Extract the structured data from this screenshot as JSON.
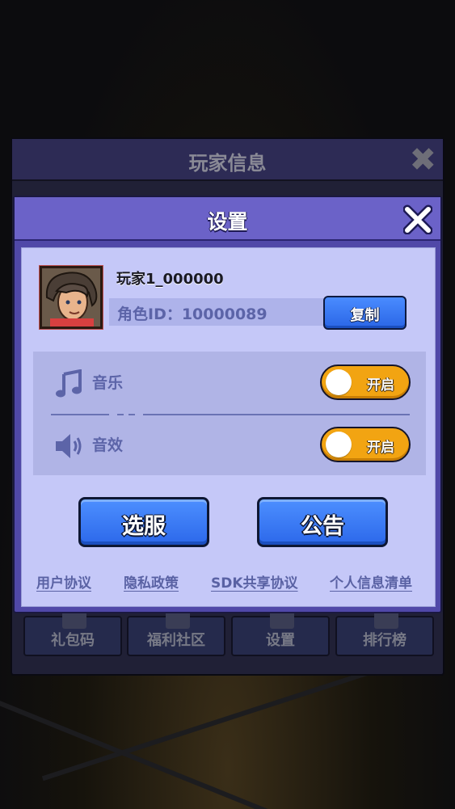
{
  "background_panel": {
    "title": "玩家信息",
    "close_glyph": "✖",
    "bottom_buttons": [
      "礼包码",
      "福利社区",
      "设置",
      "排行榜"
    ]
  },
  "dialog": {
    "title": "设置",
    "close_icon": "close-x-icon"
  },
  "profile": {
    "player_name": "玩家1_000000",
    "role_id_text": "角色ID：10000089",
    "copy_button": "复制"
  },
  "audio": {
    "music": {
      "label": "音乐",
      "icon": "music-note-icon",
      "toggle_text": "开启",
      "on": true
    },
    "sound": {
      "label": "音效",
      "icon": "speaker-icon",
      "toggle_text": "开启",
      "on": true
    }
  },
  "actions": {
    "server_select": "选服",
    "announcement": "公告"
  },
  "links": [
    "用户协议",
    "隐私政策",
    "SDK共享协议",
    "个人信息清单"
  ],
  "colors": {
    "dialog_header": "#6b62c8",
    "dialog_body": "#c5c8f8",
    "button_blue": "#3a7cff",
    "toggle_on": "#f2a412",
    "text_muted": "#5c64a8"
  }
}
